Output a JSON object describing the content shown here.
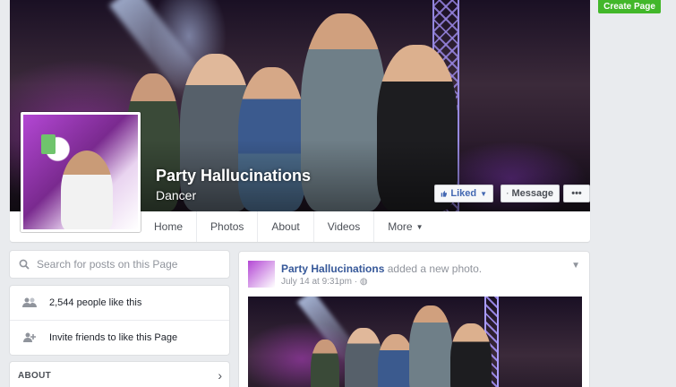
{
  "page": {
    "name": "Party Hallucinations",
    "category": "Dancer"
  },
  "cover_actions": {
    "liked": "Liked",
    "message": "Message",
    "more": "•••"
  },
  "tabs": [
    "Home",
    "Photos",
    "About",
    "Videos",
    "More"
  ],
  "create_page": "Create Page",
  "search": {
    "placeholder": "Search for posts on this Page"
  },
  "likes": {
    "count_text": "2,544 people like this",
    "invite_text": "Invite friends to like this Page"
  },
  "about": {
    "title": "ABOUT"
  },
  "post": {
    "author": "Party Hallucinations",
    "action": "added a new photo.",
    "date": "July 14 at 9:31pm",
    "separator": "·",
    "audience_icon": "globe-icon"
  },
  "icons": {
    "search": "search-icon",
    "people": "people-icon",
    "add_person": "add-person-icon",
    "chevron": "chevron-right-icon"
  }
}
